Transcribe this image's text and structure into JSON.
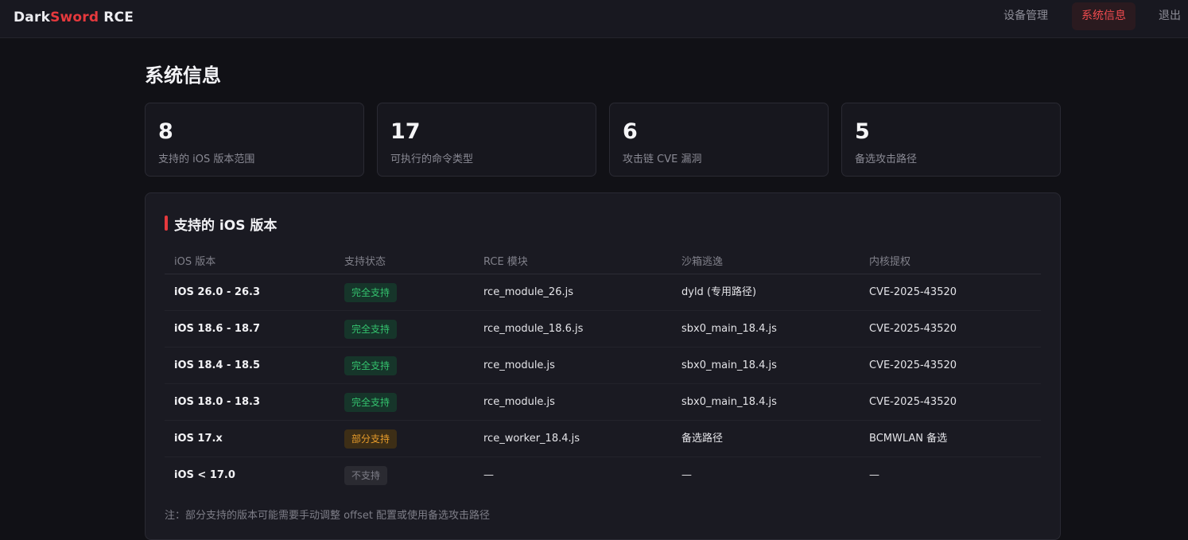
{
  "brand": {
    "dark": "Dark",
    "sword": "Sword",
    "rce": "RCE"
  },
  "nav": [
    {
      "label": "设备管理",
      "active": false
    },
    {
      "label": "系统信息",
      "active": true
    },
    {
      "label": "退出",
      "active": false
    }
  ],
  "page_title": "系统信息",
  "stats": [
    {
      "value": "8",
      "label": "支持的 iOS 版本范围"
    },
    {
      "value": "17",
      "label": "可执行的命令类型"
    },
    {
      "value": "6",
      "label": "攻击链 CVE 漏洞"
    },
    {
      "value": "5",
      "label": "备选攻击路径"
    }
  ],
  "versions_panel": {
    "title": "支持的 iOS 版本",
    "columns": [
      "iOS 版本",
      "支持状态",
      "RCE 模块",
      "沙箱逃逸",
      "内核提权"
    ],
    "rows": [
      {
        "version": "iOS 26.0 - 26.3",
        "status": "完全支持",
        "status_type": "full",
        "rce": "rce_module_26.js",
        "sandbox": "dyld (专用路径)",
        "kernel": "CVE-2025-43520"
      },
      {
        "version": "iOS 18.6 - 18.7",
        "status": "完全支持",
        "status_type": "full",
        "rce": "rce_module_18.6.js",
        "sandbox": "sbx0_main_18.4.js",
        "kernel": "CVE-2025-43520"
      },
      {
        "version": "iOS 18.4 - 18.5",
        "status": "完全支持",
        "status_type": "full",
        "rce": "rce_module.js",
        "sandbox": "sbx0_main_18.4.js",
        "kernel": "CVE-2025-43520"
      },
      {
        "version": "iOS 18.0 - 18.3",
        "status": "完全支持",
        "status_type": "full",
        "rce": "rce_module.js",
        "sandbox": "sbx0_main_18.4.js",
        "kernel": "CVE-2025-43520"
      },
      {
        "version": "iOS 17.x",
        "status": "部分支持",
        "status_type": "partial",
        "rce": "rce_worker_18.4.js",
        "sandbox": "备选路径",
        "kernel": "BCMWLAN 备选"
      },
      {
        "version": "iOS < 17.0",
        "status": "不支持",
        "status_type": "none",
        "rce": "—",
        "sandbox": "—",
        "kernel": "—"
      }
    ],
    "note": "注：部分支持的版本可能需要手动调整 offset 配置或使用备选攻击路径"
  },
  "colors": {
    "accent": "#e5393d",
    "status_full": "#34c26e",
    "status_partial": "#e89c2b",
    "status_none": "#7e7e88"
  }
}
